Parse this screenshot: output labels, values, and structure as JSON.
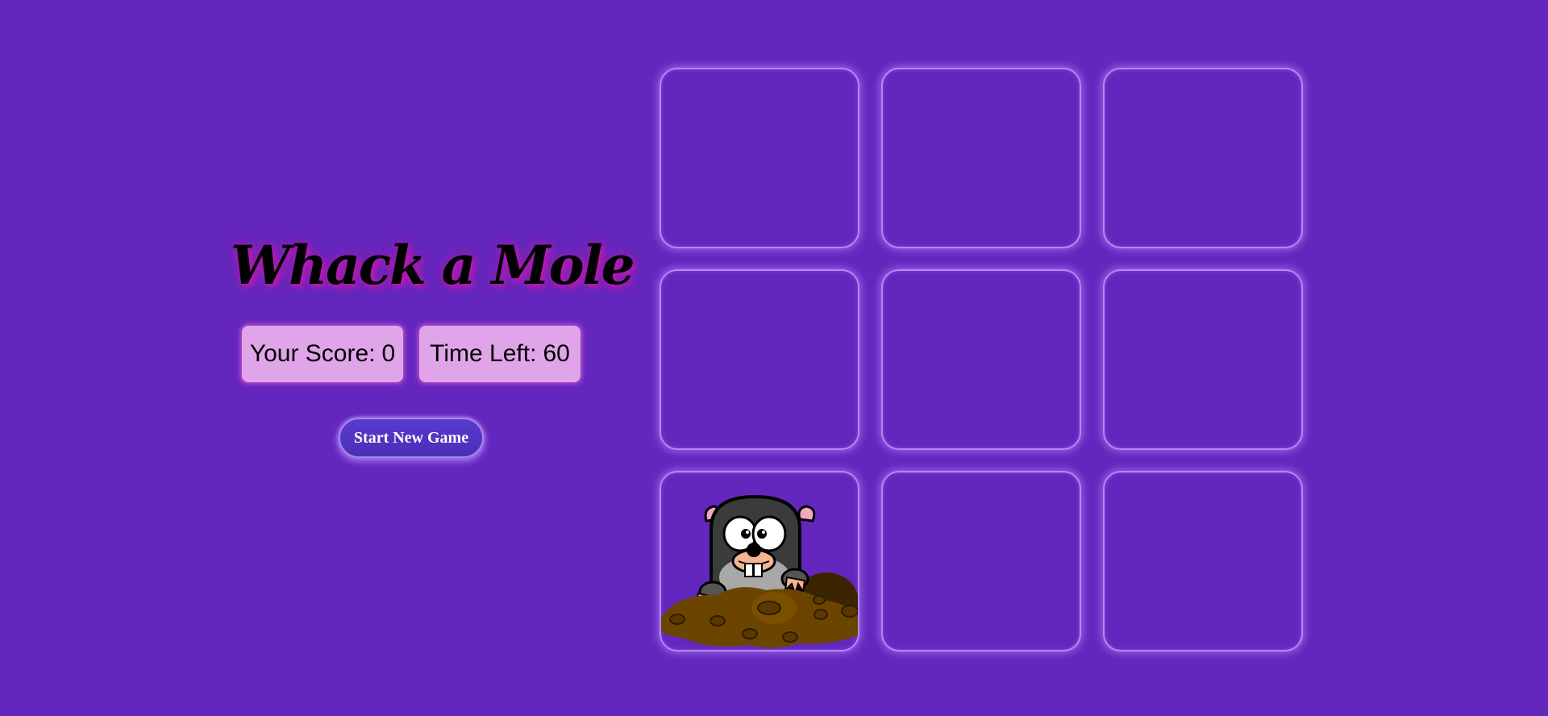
{
  "game": {
    "title": "Whack a Mole",
    "score_label": "Your Score:",
    "score_value": "0",
    "time_label": "Time Left:",
    "time_value": "60",
    "start_button_label": "Start New Game"
  },
  "board": {
    "rows": 3,
    "columns": 3,
    "mole_hole": "row 3, column 1",
    "holes": [
      {
        "row": 1,
        "col": 1,
        "has_mole": false
      },
      {
        "row": 1,
        "col": 2,
        "has_mole": false
      },
      {
        "row": 1,
        "col": 3,
        "has_mole": false
      },
      {
        "row": 2,
        "col": 1,
        "has_mole": false
      },
      {
        "row": 2,
        "col": 2,
        "has_mole": false
      },
      {
        "row": 2,
        "col": 3,
        "has_mole": false
      },
      {
        "row": 3,
        "col": 1,
        "has_mole": true
      },
      {
        "row": 3,
        "col": 2,
        "has_mole": false
      },
      {
        "row": 3,
        "col": 3,
        "has_mole": false
      }
    ]
  },
  "colors": {
    "background": "#6427bd",
    "stat_box": "#e0a5e8",
    "title_glow": "#c019b0",
    "hole_border": "#b388f0",
    "button": "#5a3bd0"
  },
  "icons": {
    "mole": "mole-icon",
    "dirt": "dirt-mound-icon"
  }
}
